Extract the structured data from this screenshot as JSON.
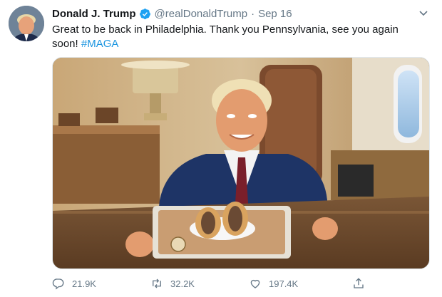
{
  "user": {
    "name": "Donald J. Trump",
    "handle": "@realDonaldTrump",
    "separator": "·",
    "date": "Sep 16"
  },
  "tweet": {
    "text_before": "Great to be back in Philadelphia. Thank you Pennsylvania, see you again soon! ",
    "hashtag": "#MAGA"
  },
  "actions": {
    "replies": "21.9K",
    "retweets": "32.2K",
    "likes": "197.4K"
  },
  "colors": {
    "verified": "#1da1f2",
    "link": "#1b95e0",
    "muted": "#657786"
  },
  "icons": [
    "verified-badge-icon",
    "chevron-down-icon",
    "reply-icon",
    "retweet-icon",
    "like-icon",
    "share-icon"
  ]
}
